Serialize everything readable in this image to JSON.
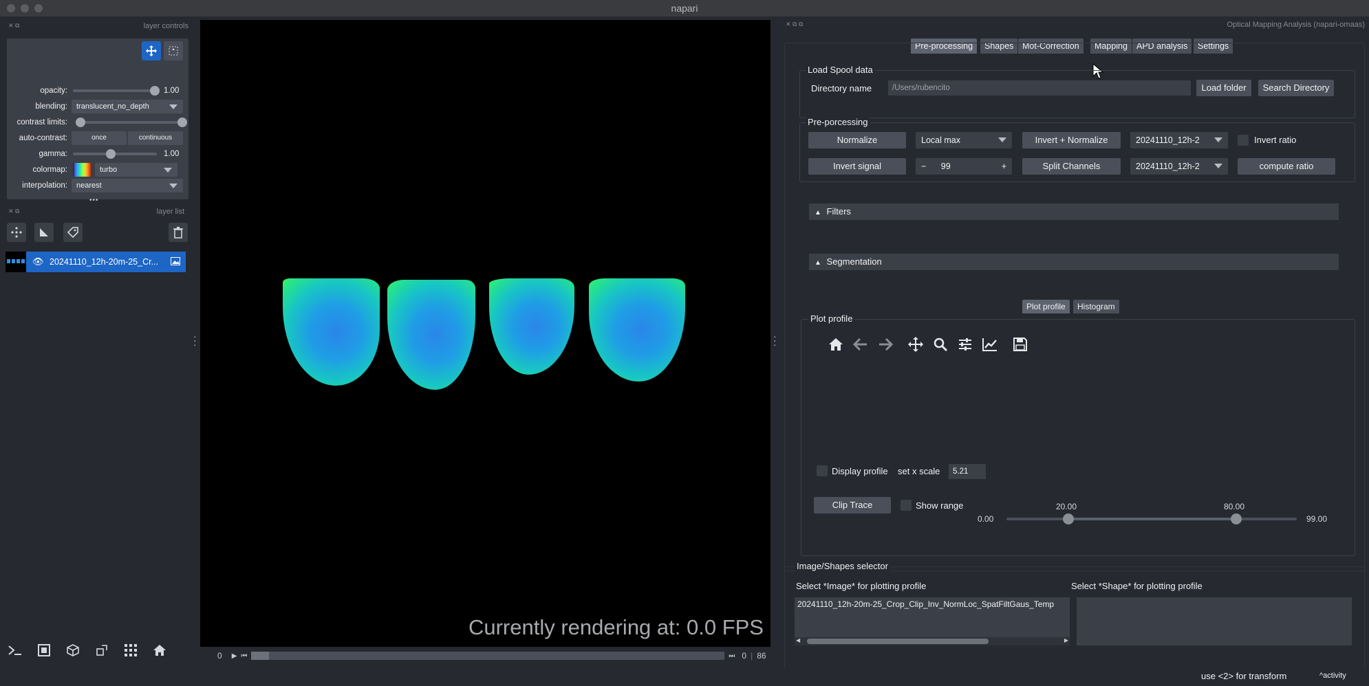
{
  "window": {
    "title": "napari"
  },
  "left": {
    "layer_controls_title": "layer controls",
    "opacity": {
      "label": "opacity:",
      "value": "1.00",
      "level": 1.0
    },
    "blending": {
      "label": "blending:",
      "value": "translucent_no_depth"
    },
    "contrast_limits": {
      "label": "contrast limits:",
      "low": 0.0,
      "high": 1.0
    },
    "auto_contrast": {
      "label": "auto-contrast:",
      "once": "once",
      "continuous": "continuous"
    },
    "gamma": {
      "label": "gamma:",
      "value": "1.00",
      "level": 0.45
    },
    "colormap": {
      "label": "colormap:",
      "value": "turbo"
    },
    "interpolation": {
      "label": "interpolation:",
      "value": "nearest"
    },
    "layer_list_title": "layer list",
    "dots": "•••",
    "layer": {
      "name": "20241110_12h-20m-25_Cr..."
    }
  },
  "canvas": {
    "fps_text": "Currently rendering at: 0.0 FPS",
    "slider_start": "0",
    "frame_current": "0",
    "frame_total": "86"
  },
  "right": {
    "panel_title": "Optical Mapping Analysis (napari-omaas)",
    "tabs": [
      "Pre-processing",
      "Shapes",
      "Mot-Correction",
      "Mapping",
      "APD analysis",
      "Settings"
    ],
    "load_spool": {
      "title": "Load Spool data",
      "dir_label": "Directory name",
      "dir_value": "/Users/rubencito",
      "load_folder": "Load folder",
      "search_directory": "Search Directory"
    },
    "preprocessing": {
      "title": "Pre-porcessing",
      "normalize": "Normalize",
      "local_max": "Local max",
      "invert_normalize": "Invert + Normalize",
      "image_select_1": "20241110_12h-2",
      "invert_ratio": "Invert ratio",
      "invert_signal": "Invert signal",
      "spin_value": "99",
      "spin_minus": "−",
      "spin_plus": "+",
      "split_channels": "Split Channels",
      "image_select_2": "20241110_12h-2",
      "compute_ratio": "compute ratio"
    },
    "filters": "Filters",
    "segmentation": "Segmentation",
    "plot_tabs": [
      "Plot profile",
      "Histogram"
    ],
    "plot_profile": {
      "title": "Plot profile",
      "display_profile": "Display profile",
      "set_x_scale": "set x scale",
      "x_scale_value": "5.21",
      "clip_trace": "Clip Trace",
      "show_range": "Show range",
      "range_min": "0.00",
      "range_max": "99.00",
      "range_low": "20.00",
      "range_high": "80.00"
    },
    "selector": {
      "title": "Image/Shapes selector",
      "image_label": "Select *Image* for plotting profile",
      "shape_label": "Select *Shape* for plotting profile",
      "image_item": "20241110_12h-20m-25_Crop_Clip_Inv_NormLoc_SpatFiltGaus_Temp"
    }
  },
  "status": {
    "hint": "use <2> for transform",
    "activity": "activity"
  },
  "colors": {
    "accent": "#1e66c6",
    "panel": "#262930",
    "widget": "#3b3f47"
  }
}
